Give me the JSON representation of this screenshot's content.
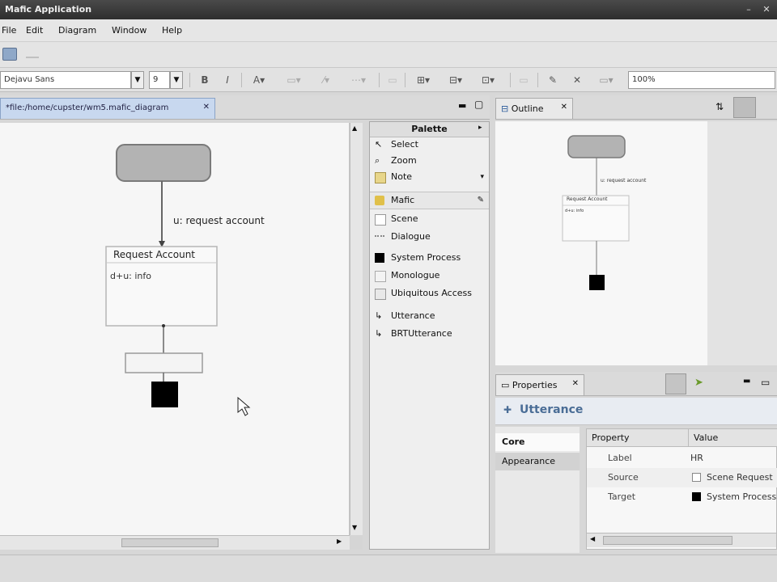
{
  "window": {
    "title": "Mafic Application",
    "controls": [
      "–",
      "✕"
    ]
  },
  "menu": [
    "File",
    "Edit",
    "Diagram",
    "Window",
    "Help"
  ],
  "toolbar": {
    "font_name": "Dejavu Sans",
    "font_size": "9",
    "bold": "B",
    "italic": "I",
    "font_color": "A",
    "zoom": "100%"
  },
  "editor": {
    "tab_label": "*file:/home/cupster/wm5.mafic_diagram",
    "diagram": {
      "transition_label": "u: request account",
      "scene_title": "Request Account",
      "scene_body": "d+u: info"
    }
  },
  "palette": {
    "title": "Palette",
    "items": [
      {
        "label": "Select",
        "icon": "arrow-pointer-icon"
      },
      {
        "label": "Zoom",
        "icon": "magnifier-icon"
      },
      {
        "label": "Note",
        "icon": "note-icon"
      },
      {
        "label": "Mafic",
        "icon": "folder-icon",
        "selected": true
      },
      {
        "label": "Scene",
        "icon": "rectangle-icon"
      },
      {
        "label": "Dialogue",
        "icon": "dialogue-icon"
      },
      {
        "label": "System Process",
        "icon": "black-square-icon"
      },
      {
        "label": "Monologue",
        "icon": "monologue-icon"
      },
      {
        "label": "Ubiquitous Access",
        "icon": "ubiquitous-icon"
      },
      {
        "label": "Utterance",
        "icon": "utterance-arrow-icon"
      },
      {
        "label": "BRTUtterance",
        "icon": "utterance-arrow-icon"
      }
    ]
  },
  "outline": {
    "tab_label": "Outline",
    "mini_label": "u: request account",
    "mini_scene_title": "Request Account",
    "mini_scene_body": "d+u: info"
  },
  "properties": {
    "tab_label": "Properties",
    "title": "Utterance",
    "sections": [
      "Core",
      "Appearance"
    ],
    "active_section": "Core",
    "columns": [
      "Property",
      "Value"
    ],
    "rows": [
      {
        "key": "Label",
        "value": "HR"
      },
      {
        "key": "Source",
        "value": "Scene Request"
      },
      {
        "key": "Target",
        "value": "System Process"
      }
    ]
  }
}
